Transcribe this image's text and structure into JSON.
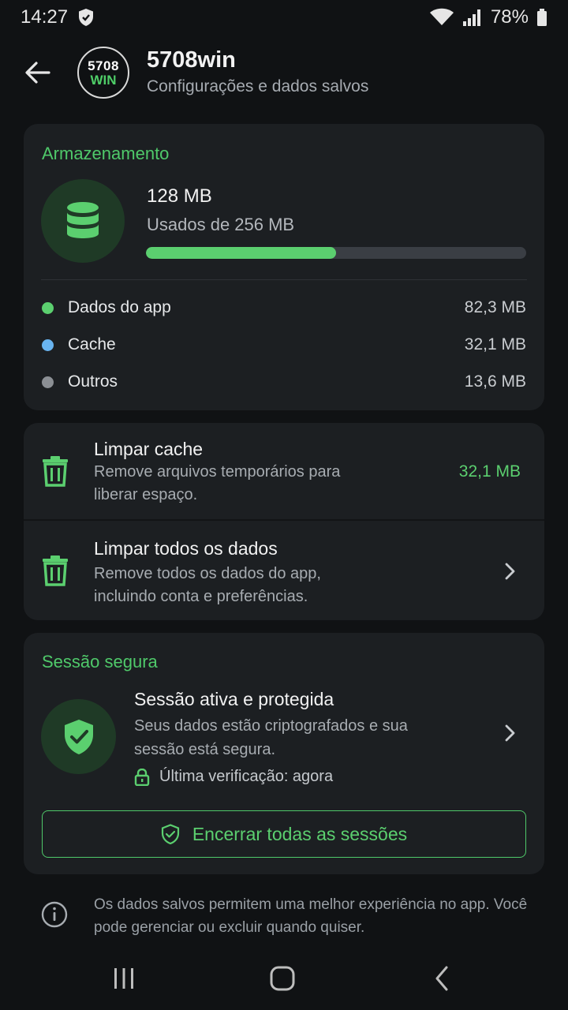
{
  "status_bar": {
    "time": "14:27",
    "battery": "78%"
  },
  "header": {
    "back_icon": "arrow-left-icon",
    "logo_top": "5708",
    "logo_bottom": "WIN",
    "title": "5708win",
    "subtitle": "Configurações e dados salvos"
  },
  "storage": {
    "title": "Armazenamento",
    "used": "128 MB",
    "of_total": "Usados de 256 MB",
    "progress_fraction": 0.5,
    "legend": [
      {
        "label": "Dados do app",
        "value": "82,3 MB",
        "color": "#5bcf6f"
      },
      {
        "label": "Cache",
        "value": "32,1 MB",
        "color": "#69b4f0"
      },
      {
        "label": "Outros",
        "value": "13,6 MB",
        "color": "#8b8f94"
      }
    ]
  },
  "actions": {
    "clear_cache": {
      "title": "Limpar cache",
      "desc": "Remove arquivos temporários para liberar espaço.",
      "size": "32,1 MB"
    },
    "clear_all": {
      "title": "Limpar todos os dados",
      "desc": "Remove todos os dados do app, incluindo conta e preferências."
    }
  },
  "session": {
    "title": "Sessão segura",
    "heading": "Sessão ativa e protegida",
    "desc": "Seus dados estão criptografados e sua sessão está segura.",
    "verify": "Última verificação: agora",
    "end_button": "Encerrar todas as sessões"
  },
  "info_note": "Os dados salvos permitem uma melhor experiência no app. Você pode gerenciar ou excluir quando quiser.",
  "colors": {
    "accent": "#5bcf6f",
    "background": "#101214",
    "card": "#1c1f22"
  }
}
